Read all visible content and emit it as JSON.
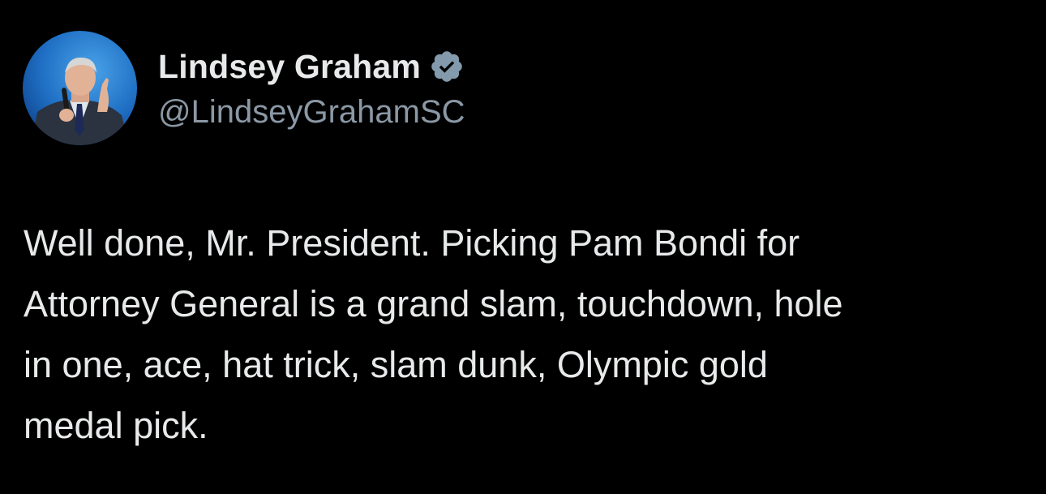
{
  "tweet": {
    "author": {
      "display_name": "Lindsey Graham",
      "handle": "@LindseyGrahamSC",
      "verified_icon": "verified-badge-icon",
      "avatar": "profile-photo"
    },
    "text": "Well done, Mr. President. Picking Pam Bondi for\nAttorney General is a grand slam, touchdown, hole\nin one, ace, hat trick, slam dunk, Olympic gold\nmedal pick."
  },
  "colors": {
    "background": "#000000",
    "text": "#e7e9ea",
    "handle": "#8b98a5",
    "verified_badge": "#829aab"
  }
}
